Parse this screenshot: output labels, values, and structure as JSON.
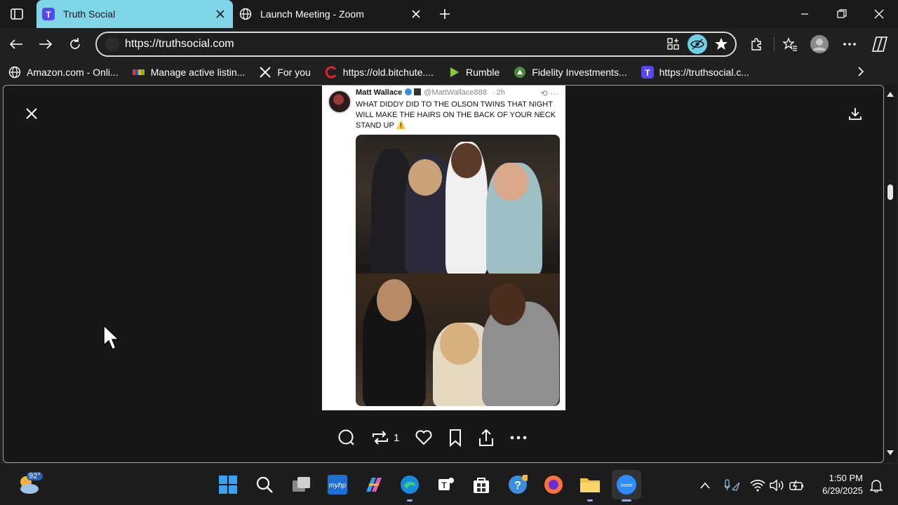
{
  "browser": {
    "tabs": [
      {
        "label": "Truth Social",
        "active": true
      },
      {
        "label": "Launch Meeting - Zoom",
        "active": false
      }
    ],
    "address": "https://truthsocial.com",
    "bookmarks": [
      {
        "label": "Amazon.com - Onli...",
        "icon": "globe-icon"
      },
      {
        "label": "Manage active listin...",
        "icon": "ebay-icon"
      },
      {
        "label": "For you",
        "icon": "x-icon"
      },
      {
        "label": "https://old.bitchute....",
        "icon": "bitchute-icon"
      },
      {
        "label": "Rumble",
        "icon": "rumble-icon"
      },
      {
        "label": "Fidelity Investments...",
        "icon": "fidelity-icon"
      },
      {
        "label": "https://truthsocial.c...",
        "icon": "truthsocial-icon"
      }
    ]
  },
  "post": {
    "author_name": "Matt Wallace",
    "author_handle": "@MattWallace888",
    "time": "· 2h",
    "text": "WHAT DIDDY DID TO THE OLSON TWINS THAT NIGHT WILL MAKE THE HAIRS ON THE BACK OF YOUR NECK STAND UP ⚠️",
    "repost_count": "1"
  },
  "taskbar": {
    "temperature": "92°",
    "time": "1:50 PM",
    "date": "6/29/2025"
  },
  "colors": {
    "active_tab": "#7fd6e8",
    "background": "#171717",
    "accent_blue": "#3a8de0"
  }
}
